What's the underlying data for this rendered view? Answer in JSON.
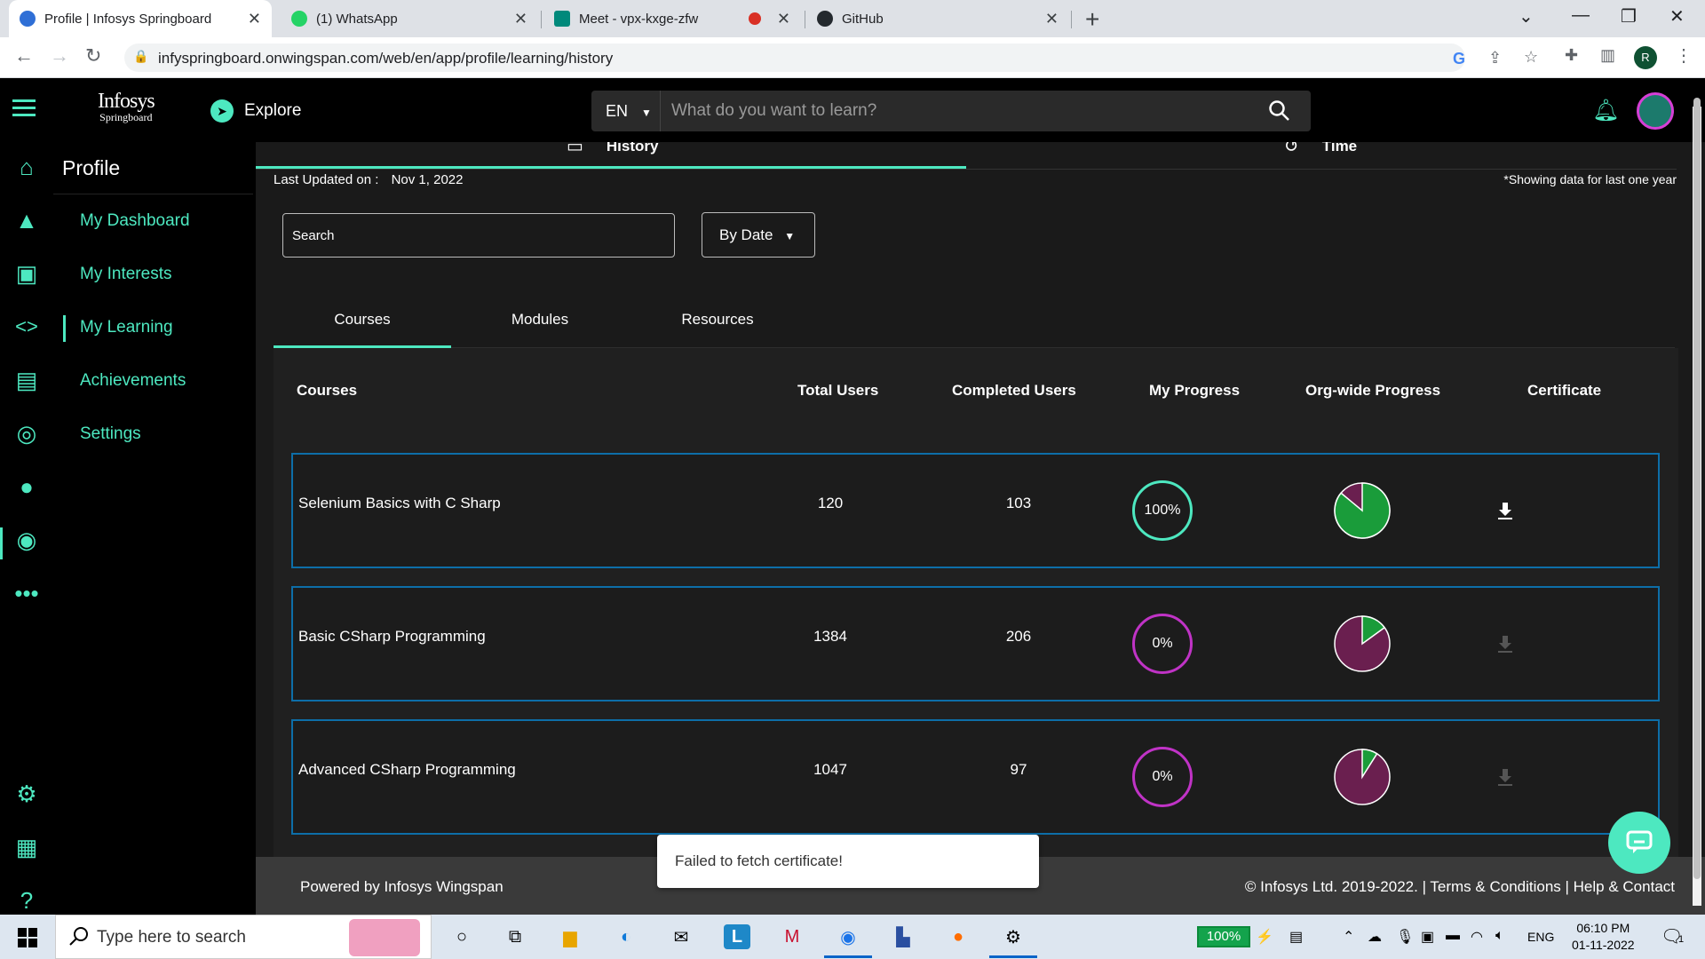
{
  "browser": {
    "tabs": [
      {
        "title": "Profile | Infosys Springboard",
        "favicon_color": "#2f6fd6"
      },
      {
        "title": "(1) WhatsApp",
        "favicon_color": "#25d366"
      },
      {
        "title": "Meet - vpx-kxge-zfw",
        "favicon_color": "#00897b"
      },
      {
        "title": "GitHub",
        "favicon_color": "#24292e"
      }
    ],
    "url": "infyspringboard.onwingspan.com/web/en/app/profile/learning/history",
    "profile_initial": "R"
  },
  "header": {
    "logo_line1": "Infosys",
    "logo_line2": "Springboard",
    "explore_label": "Explore",
    "language": "EN",
    "search_placeholder": "What do you want to learn?"
  },
  "sidebar": {
    "title": "Profile",
    "items": [
      {
        "label": "My Dashboard"
      },
      {
        "label": "My Interests"
      },
      {
        "label": "My Learning"
      },
      {
        "label": "Achievements"
      },
      {
        "label": "Settings"
      }
    ]
  },
  "main": {
    "top_tabs": [
      {
        "label": "History"
      },
      {
        "label": "Time"
      }
    ],
    "last_updated_label": "Last Updated on :",
    "last_updated_value": "Nov 1, 2022",
    "showing_note": "*Showing data for last one year",
    "search_placeholder": "Search",
    "sort_label": "By Date",
    "sub_tabs": [
      {
        "label": "Courses"
      },
      {
        "label": "Modules"
      },
      {
        "label": "Resources"
      }
    ],
    "columns": {
      "courses": "Courses",
      "total_users": "Total Users",
      "completed_users": "Completed Users",
      "my_progress": "My Progress",
      "org_progress": "Org-wide Progress",
      "certificate": "Certificate"
    },
    "rows": [
      {
        "course": "Selenium Basics with C Sharp",
        "total_users": "120",
        "completed_users": "103",
        "my_progress": "100%",
        "my_progress_value": 100,
        "org_completed_fraction": 0.86,
        "certificate_enabled": true
      },
      {
        "course": "Basic CSharp Programming",
        "total_users": "1384",
        "completed_users": "206",
        "my_progress": "0%",
        "my_progress_value": 0,
        "org_completed_fraction": 0.15,
        "certificate_enabled": false
      },
      {
        "course": "Advanced CSharp Programming",
        "total_users": "1047",
        "completed_users": "97",
        "my_progress": "0%",
        "my_progress_value": 0,
        "org_completed_fraction": 0.09,
        "certificate_enabled": false
      }
    ]
  },
  "footer": {
    "powered_by": "Powered by Infosys Wingspan",
    "copyright": "© Infosys Ltd. 2019-2022. | Terms & Conditions | Help & Contact"
  },
  "toast": {
    "message": "Failed to fetch certificate!"
  },
  "taskbar": {
    "search_placeholder": "Type here to search",
    "battery": "100%",
    "language": "ENG",
    "time": "06:10 PM",
    "date": "01-11-2022",
    "notification_count": "1"
  },
  "colors": {
    "accent": "#4de8c0",
    "completed_green": "#1a9c3a",
    "incomplete_purple": "#6a1f4f",
    "progress_done": "#4de8c0",
    "progress_none": "#c033c6",
    "row_border": "#0d6ea8"
  }
}
